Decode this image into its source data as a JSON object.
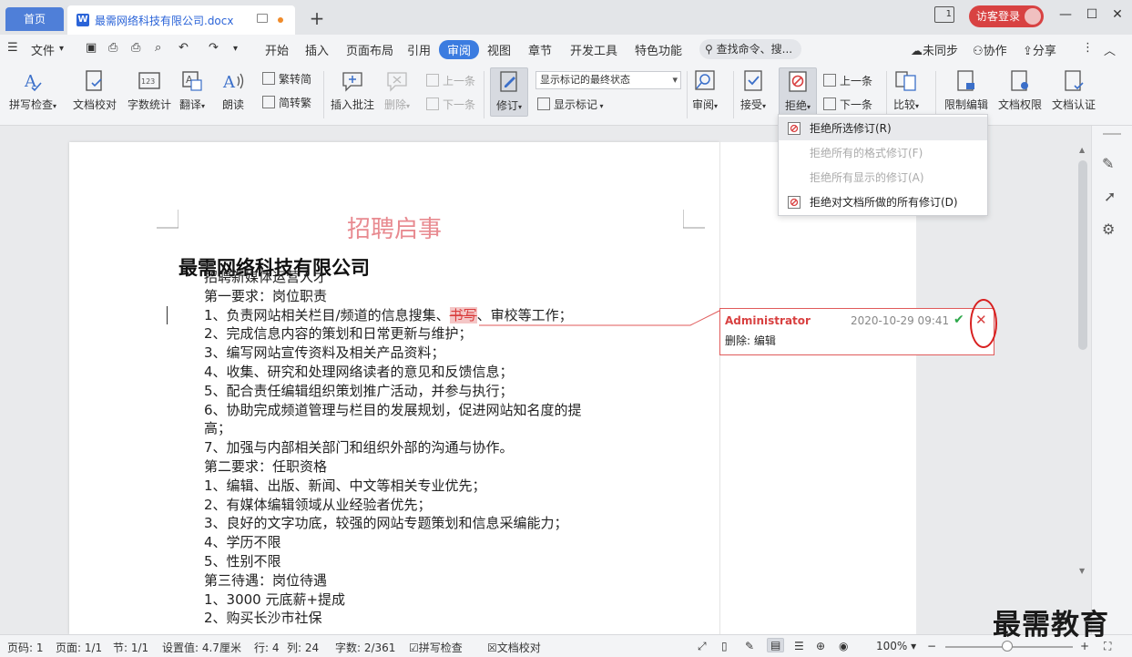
{
  "titlebar": {
    "home_tab": "首页",
    "doc_tab": "最需网络科技有限公司.docx",
    "login": "访客登录",
    "layout_badge": "1"
  },
  "menu": {
    "file": "文件",
    "items": [
      "开始",
      "插入",
      "页面布局",
      "引用",
      "审阅",
      "视图",
      "章节",
      "开发工具",
      "特色功能"
    ],
    "active": "审阅",
    "search_placeholder": "查找命令、搜...",
    "sync": "未同步",
    "collab": "协作",
    "share": "分享"
  },
  "ribbon": {
    "spell_check": "拼写检查",
    "doc_proof": "文档校对",
    "word_count": "字数统计",
    "translate": "翻译",
    "read_aloud": "朗读",
    "trad_to_simp": "繁转简",
    "simp_to_trad": "简转繁",
    "insert_comment": "插入批注",
    "delete": "删除",
    "prev_comment": "上一条",
    "next_comment": "下一条",
    "revise": "修订",
    "markup_state": "显示标记的最终状态",
    "show_markup": "显示标记",
    "review": "审阅",
    "accept": "接受",
    "reject": "拒绝",
    "prev_change": "上一条",
    "next_change": "下一条",
    "compare": "比较",
    "restrict_edit": "限制编辑",
    "doc_permission": "文档权限",
    "doc_cert": "文档认证"
  },
  "reject_menu": [
    {
      "label": "拒绝所选修订(R)",
      "enabled": true
    },
    {
      "label": "拒绝所有的格式修订(F)",
      "enabled": false
    },
    {
      "label": "拒绝所有显示的修订(A)",
      "enabled": false
    },
    {
      "label": "拒绝对文档所做的所有修订(D)",
      "enabled": true
    }
  ],
  "document": {
    "title": "招聘启事",
    "company": "最需网络科技有限公司",
    "line_0": "招聘新媒体运营人才",
    "line_1": "第一要求：岗位职责",
    "line_2_a": "1、负责网站相关栏目/频道的信息搜集、",
    "line_2_del": "书写",
    "line_2_b": "、审校等工作；",
    "line_3": "2、完成信息内容的策划和日常更新与维护；",
    "line_4": "3、编写网站宣传资料及相关产品资料；",
    "line_5": "4、收集、研究和处理网络读者的意见和反馈信息；",
    "line_6": "5、配合责任编辑组织策划推广活动，并参与执行；",
    "line_7": "6、协助完成频道管理与栏目的发展规划，促进网站知名度的提",
    "line_8": "高；",
    "line_9": "7、加强与内部相关部门和组织外部的沟通与协作。",
    "line_10": "第二要求：任职资格",
    "line_11": "1、编辑、出版、新闻、中文等相关专业优先；",
    "line_12": "2、有媒体编辑领域从业经验者优先；",
    "line_13": "3、良好的文字功底，较强的网站专题策划和信息采编能力；",
    "line_14": "4、学历不限",
    "line_15": "5、性别不限",
    "line_16": "第三待遇：岗位待遇",
    "line_17": "1、3000 元底薪+提成",
    "line_18": "2、购买长沙市社保"
  },
  "comment": {
    "author": "Administrator",
    "time": "2020-10-29 09:41",
    "body": "删除: 编辑"
  },
  "status": {
    "page_no": "页码: 1",
    "page": "页面: 1/1",
    "section": "节: 1/1",
    "setting": "设置值: 4.7厘米",
    "row": "行: 4",
    "col": "列: 24",
    "words": "字数: 2/361",
    "spell": "拼写检查",
    "proof": "文档校对",
    "zoom": "100%"
  },
  "watermark": "最需教育",
  "colors": {
    "accent": "#3b7ce0",
    "reject_red": "#d84040",
    "title_pink": "#e88a90"
  }
}
